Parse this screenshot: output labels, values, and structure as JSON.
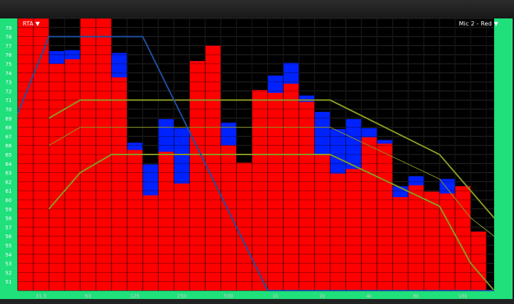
{
  "menus": {
    "rta_label": "RTA ▼",
    "mic_label": "Mic 2 - Red ▼"
  },
  "colors": {
    "background": "#000000",
    "grid": "#3a3a3a",
    "side_rail": "#1fe07a",
    "bars_current": "#ff0000",
    "bars_peak_hold": "#0022ff",
    "target_curve": "#1f4f9e",
    "tolerance_curve": "#8a9a22",
    "tick_text": "#ffffff",
    "x_label_text": "#cccccc"
  },
  "chart_data": {
    "type": "bar",
    "y_ticks": [
      "79",
      "78",
      "77",
      "76",
      "75",
      "74",
      "73",
      "72",
      "71",
      "70",
      "69",
      "68",
      "67",
      "66",
      "65",
      "64",
      "63",
      "62",
      "61",
      "60",
      "59",
      "58",
      "57",
      "56",
      "55",
      "54",
      "53",
      "52",
      "51"
    ],
    "x_ticks": [
      "31.5",
      "63",
      "125",
      "250",
      "500",
      "1k",
      "2k",
      "4k",
      "8k",
      "16k"
    ],
    "ylim": [
      50,
      80
    ],
    "xlim": [
      0,
      30.5
    ],
    "series": [
      {
        "values": [
          80,
          80,
          75,
          75.5,
          80,
          80,
          73.5,
          65.5,
          60.5,
          65.3,
          61.8,
          75.3,
          77,
          66,
          64.1,
          72.1,
          71.8,
          72.8,
          70.8,
          65,
          62.9,
          63.4,
          66.9,
          66.2,
          60.3,
          61.6,
          60.9,
          60.7,
          61.5,
          56.5
        ]
      },
      {
        "values": [
          80,
          79.1,
          76.4,
          76.5,
          80,
          80,
          76.2,
          66.3,
          63.9,
          68.9,
          67.9,
          75.3,
          77,
          68.5,
          64.1,
          72.1,
          73.7,
          75.1,
          71.5,
          69.7,
          67.8,
          68.9,
          67.9,
          66.6,
          61.5,
          62.6,
          60.9,
          62.3,
          61.5,
          56.5
        ]
      }
    ],
    "target_curve": {
      "x": [
        0,
        2,
        8,
        16,
        30.5
      ],
      "y": [
        69.5,
        78,
        78,
        50,
        50
      ]
    },
    "tolerance_curves": [
      {
        "x": [
          2,
          4,
          6,
          15,
          20,
          27,
          29,
          30.5
        ],
        "y": [
          69,
          71,
          71,
          71,
          71,
          65,
          61,
          58
        ]
      },
      {
        "x": [
          2,
          4,
          6,
          15,
          20,
          27,
          29,
          30.5
        ],
        "y": [
          66,
          68,
          68,
          68,
          68,
          62.3,
          58,
          56
        ]
      },
      {
        "x": [
          2,
          4,
          6,
          15,
          20,
          27,
          29,
          30.5
        ],
        "y": [
          59,
          63,
          65,
          65,
          65,
          59.3,
          53,
          50
        ]
      }
    ],
    "grid": true
  }
}
